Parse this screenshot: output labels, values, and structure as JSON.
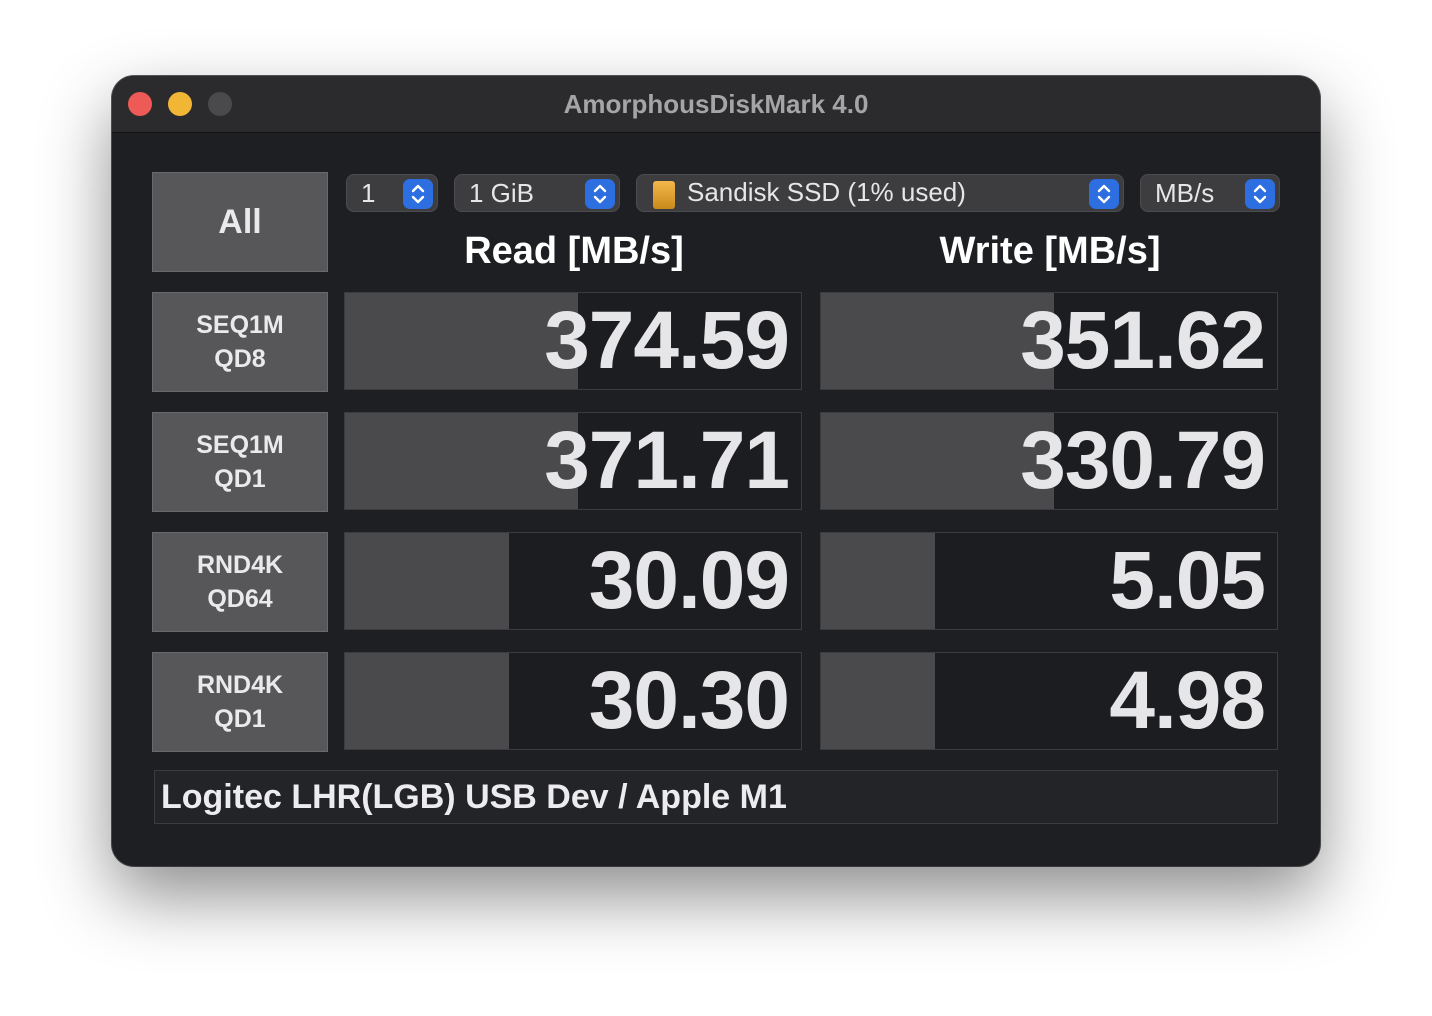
{
  "window": {
    "title": "AmorphousDiskMark 4.0"
  },
  "controls": {
    "all_label": "All",
    "count": "1",
    "size": "1 GiB",
    "drive": "Sandisk SSD (1% used)",
    "unit": "MB/s"
  },
  "headers": {
    "read": "Read [MB/s]",
    "write": "Write [MB/s]"
  },
  "rows": [
    {
      "line1": "SEQ1M",
      "line2": "QD8",
      "read": "374.59",
      "write": "351.62",
      "read_fill": 0.51,
      "write_fill": 0.51
    },
    {
      "line1": "SEQ1M",
      "line2": "QD1",
      "read": "371.71",
      "write": "330.79",
      "read_fill": 0.51,
      "write_fill": 0.51
    },
    {
      "line1": "RND4K",
      "line2": "QD64",
      "read": "30.09",
      "write": "5.05",
      "read_fill": 0.36,
      "write_fill": 0.25
    },
    {
      "line1": "RND4K",
      "line2": "QD1",
      "read": "30.30",
      "write": "4.98",
      "read_fill": 0.36,
      "write_fill": 0.25
    }
  ],
  "status": "Logitec LHR(LGB) USB Dev / Apple M1",
  "colors": {
    "bar": "#4a4a4c",
    "stepper": "#2d6fe0",
    "close": "#ee5a55",
    "minimize": "#f2b637"
  }
}
